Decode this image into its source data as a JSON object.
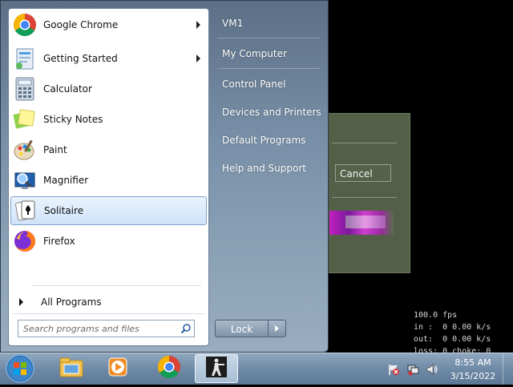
{
  "background_dialog": {
    "cancel_label": "Cancel"
  },
  "stats_overlay": {
    "fps": "100.0 fps",
    "in_line": "in :  0 0.00 k/s",
    "out_line": "out:  0 0.00 k/s",
    "loss_line": "loss: 0 choke: 0"
  },
  "start_menu": {
    "programs": [
      {
        "label": "Google Chrome",
        "icon": "chrome-icon",
        "has_submenu": true
      },
      {
        "label": "Getting Started",
        "icon": "getting-started-icon",
        "has_submenu": true
      },
      {
        "label": "Calculator",
        "icon": "calculator-icon",
        "has_submenu": false
      },
      {
        "label": "Sticky Notes",
        "icon": "sticky-notes-icon",
        "has_submenu": false
      },
      {
        "label": "Paint",
        "icon": "paint-icon",
        "has_submenu": false
      },
      {
        "label": "Magnifier",
        "icon": "magnifier-icon",
        "has_submenu": false
      },
      {
        "label": "Solitaire",
        "icon": "solitaire-icon",
        "has_submenu": false,
        "highlighted": true
      },
      {
        "label": "Firefox",
        "icon": "firefox-icon",
        "has_submenu": false
      }
    ],
    "all_programs_label": "All Programs",
    "search_placeholder": "Search programs and files",
    "right_items": [
      "VM1",
      "My Computer",
      "Control Panel",
      "Devices and Printers",
      "Default Programs",
      "Help and Support"
    ],
    "lock_label": "Lock"
  },
  "taskbar": {
    "pinned": [
      "start-orb",
      "explorer-icon",
      "media-player-icon",
      "chrome-icon",
      "counter-strike-icon"
    ],
    "clock_time": "8:55 AM",
    "clock_date": "3/15/2022"
  },
  "colors": {
    "highlight_bg": "#cfe3fa",
    "start_menu_right": "#7890a8",
    "taskbar": "#6f8aa6",
    "dialog_bg": "#535f47"
  }
}
